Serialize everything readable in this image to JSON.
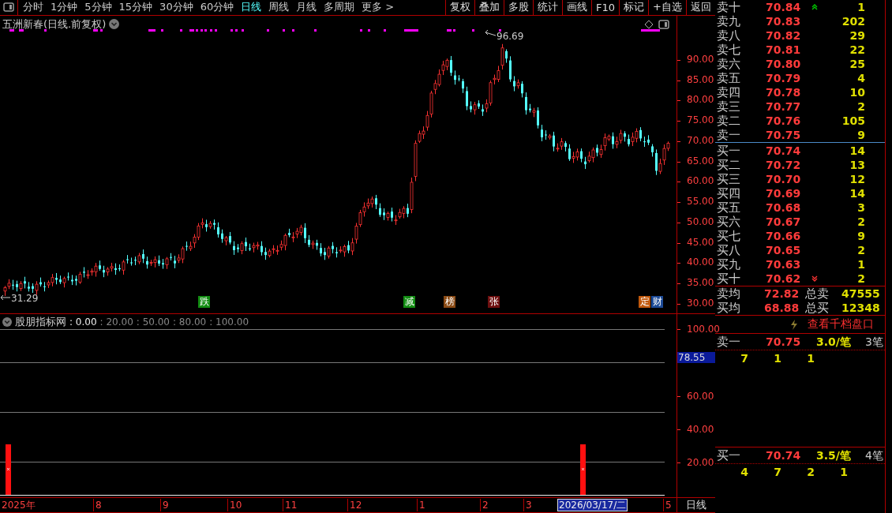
{
  "toolbar": {
    "periods": [
      {
        "label": "分时",
        "selected": false
      },
      {
        "label": "1分钟",
        "selected": false
      },
      {
        "label": "5分钟",
        "selected": false
      },
      {
        "label": "15分钟",
        "selected": false
      },
      {
        "label": "30分钟",
        "selected": false
      },
      {
        "label": "60分钟",
        "selected": false
      },
      {
        "label": "日线",
        "selected": true
      },
      {
        "label": "周线",
        "selected": false
      },
      {
        "label": "月线",
        "selected": false
      },
      {
        "label": "多周期",
        "selected": false
      },
      {
        "label": "更多 >",
        "selected": false
      }
    ],
    "buttons": [
      "复权",
      "叠加",
      "多股",
      "统计",
      "画线",
      "F10",
      "标记",
      "+自选",
      "返回"
    ]
  },
  "chart": {
    "title": "五洲新春(日线.前复权)",
    "high_label": "96.69",
    "low_label": "31.29",
    "yticks": [
      "90.00",
      "85.00",
      "80.00",
      "75.00",
      "70.00",
      "65.00",
      "60.00",
      "55.00",
      "50.00",
      "45.00",
      "40.00",
      "35.00",
      "30.00"
    ],
    "events": [
      {
        "label": "跌",
        "color": "#128c12"
      },
      {
        "label": "减",
        "color": "#128c12"
      },
      {
        "label": "榜",
        "color": "#8a4a14"
      },
      {
        "label": "张",
        "color": "#6e1010"
      },
      {
        "label": "定",
        "color": "#c0580c"
      },
      {
        "label": "财",
        "color": "#1c4a96"
      }
    ]
  },
  "indicator": {
    "name": "股朋指标网",
    "params": [
      {
        "text": ": 0.00",
        "highlighted": true
      },
      {
        "text": ": 20.00",
        "highlighted": false
      },
      {
        "text": ": 50.00",
        "highlighted": false
      },
      {
        "text": ": 80.00",
        "highlighted": false
      },
      {
        "text": ": 100.00",
        "highlighted": false
      }
    ],
    "yticks": [
      "100.00",
      "60.00",
      "40.00",
      "20.00"
    ],
    "current": "78.55"
  },
  "xaxis": {
    "labels": [
      "2025年",
      "8",
      "9",
      "10",
      "11",
      "12",
      "1",
      "2",
      "3",
      "5"
    ],
    "cursor_date": "2026/03/17/二",
    "period": "日线"
  },
  "order_book": {
    "asks": [
      {
        "label": "卖十",
        "price": "70.84",
        "volume": "1",
        "up": true,
        "down": false
      },
      {
        "label": "卖九",
        "price": "70.83",
        "volume": "202",
        "up": false,
        "down": false
      },
      {
        "label": "卖八",
        "price": "70.82",
        "volume": "29",
        "up": false,
        "down": false
      },
      {
        "label": "卖七",
        "price": "70.81",
        "volume": "22",
        "up": false,
        "down": false
      },
      {
        "label": "卖六",
        "price": "70.80",
        "volume": "25",
        "up": false,
        "down": false
      },
      {
        "label": "卖五",
        "price": "70.79",
        "volume": "4",
        "up": false,
        "down": false
      },
      {
        "label": "卖四",
        "price": "70.78",
        "volume": "10",
        "up": false,
        "down": false
      },
      {
        "label": "卖三",
        "price": "70.77",
        "volume": "2",
        "up": false,
        "down": false
      },
      {
        "label": "卖二",
        "price": "70.76",
        "volume": "105",
        "up": false,
        "down": false
      },
      {
        "label": "卖一",
        "price": "70.75",
        "volume": "9",
        "up": false,
        "down": false
      }
    ],
    "bids": [
      {
        "label": "买一",
        "price": "70.74",
        "volume": "14",
        "up": false,
        "down": false
      },
      {
        "label": "买二",
        "price": "70.72",
        "volume": "13",
        "up": false,
        "down": false
      },
      {
        "label": "买三",
        "price": "70.70",
        "volume": "12",
        "up": false,
        "down": false
      },
      {
        "label": "买四",
        "price": "70.69",
        "volume": "14",
        "up": false,
        "down": false
      },
      {
        "label": "买五",
        "price": "70.68",
        "volume": "3",
        "up": false,
        "down": false
      },
      {
        "label": "买六",
        "price": "70.67",
        "volume": "2",
        "up": false,
        "down": false
      },
      {
        "label": "买七",
        "price": "70.66",
        "volume": "9",
        "up": false,
        "down": false
      },
      {
        "label": "买八",
        "price": "70.65",
        "volume": "2",
        "up": false,
        "down": false
      },
      {
        "label": "买九",
        "price": "70.63",
        "volume": "1",
        "up": false,
        "down": false
      },
      {
        "label": "买十",
        "price": "70.62",
        "volume": "2",
        "up": false,
        "down": true
      }
    ],
    "summary": [
      {
        "label": "卖均",
        "price": "72.82",
        "total_label": "总卖",
        "total": "47555"
      },
      {
        "label": "买均",
        "price": "68.88",
        "total_label": "总买",
        "total": "12348"
      }
    ],
    "depth_link": "查看千档盘口",
    "queues": [
      {
        "label": "卖一",
        "price": "70.75",
        "avg": "3.0/笔",
        "count": "3笔",
        "orders": [
          "7",
          "1",
          "1"
        ]
      },
      {
        "label": "买一",
        "price": "70.74",
        "avg": "3.5/笔",
        "count": "4笔",
        "orders": [
          "4",
          "7",
          "2",
          "1"
        ]
      }
    ]
  }
}
